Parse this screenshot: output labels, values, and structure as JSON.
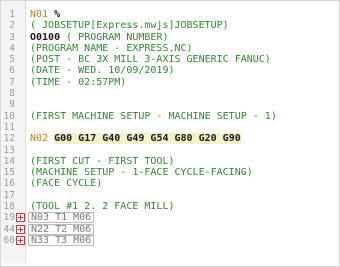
{
  "editor": {
    "lines": [
      {
        "num": "1",
        "segments": [
          {
            "text": "N01 ",
            "color": "gold"
          },
          {
            "text": "%",
            "color": "black"
          }
        ]
      },
      {
        "num": "2",
        "segments": [
          {
            "text": "( JOBSETUP[Express.mwjs]JOBSETUP)",
            "color": "green"
          }
        ]
      },
      {
        "num": "3",
        "segments": [
          {
            "text": "O0100",
            "color": "black"
          },
          {
            "text": " ( PROGRAM NUMBER)",
            "color": "green"
          }
        ]
      },
      {
        "num": "4",
        "segments": [
          {
            "text": "(PROGRAM NAME - EXPRESS.NC)",
            "color": "green"
          }
        ]
      },
      {
        "num": "5",
        "segments": [
          {
            "text": "(POST - BC 3X MILL 3-AXIS GENERIC FANUC)",
            "color": "green"
          }
        ]
      },
      {
        "num": "6",
        "segments": [
          {
            "text": "(DATE - WED. 10/09/2019)",
            "color": "green"
          }
        ]
      },
      {
        "num": "7",
        "segments": [
          {
            "text": "(TIME - 02:57PM)",
            "color": "green"
          }
        ]
      },
      {
        "num": "8",
        "segments": []
      },
      {
        "num": "9",
        "segments": []
      },
      {
        "num": "10",
        "segments": [
          {
            "text": "(FIRST MACHINE SETUP - MACHINE SETUP - 1)",
            "color": "green"
          }
        ]
      },
      {
        "num": "11",
        "segments": []
      },
      {
        "num": "12",
        "segments": [
          {
            "text": "N02 ",
            "color": "gold"
          },
          {
            "text": "G00 G17 G40 G49 G54 G80 G20 G90",
            "color": "gcode"
          }
        ]
      },
      {
        "num": "13",
        "segments": []
      },
      {
        "num": "14",
        "segments": [
          {
            "text": "(FIRST CUT - FIRST TOOL)",
            "color": "green"
          }
        ]
      },
      {
        "num": "15",
        "segments": [
          {
            "text": "(MACHINE SETUP - 1-FACE CYCLE-FACING)",
            "color": "green"
          }
        ]
      },
      {
        "num": "16",
        "segments": [
          {
            "text": "(FACE CYCLE)",
            "color": "green"
          }
        ]
      },
      {
        "num": "17",
        "segments": []
      },
      {
        "num": "18",
        "segments": [
          {
            "text": "(TOOL #1 2. 2 FACE MILL)",
            "color": "green"
          }
        ]
      },
      {
        "num": "19",
        "fold": true,
        "collapsed": true,
        "segments": [
          {
            "text": "N03 T1 M06",
            "color": "gray"
          }
        ]
      },
      {
        "num": "44",
        "fold": true,
        "collapsed": true,
        "segments": [
          {
            "text": "N22 T2 M06",
            "color": "gray"
          }
        ]
      },
      {
        "num": "60",
        "fold": true,
        "collapsed": true,
        "segments": [
          {
            "text": "N33 T3 M06",
            "color": "gray"
          }
        ]
      }
    ]
  }
}
